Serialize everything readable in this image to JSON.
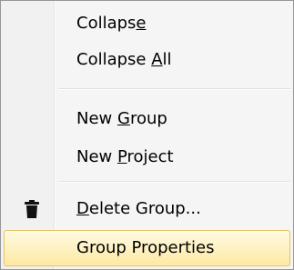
{
  "menu": {
    "items": [
      {
        "pre": "Collaps",
        "mnemonic": "e",
        "post": ""
      },
      {
        "pre": "Collapse ",
        "mnemonic": "A",
        "post": "ll"
      },
      {
        "pre": "New ",
        "mnemonic": "G",
        "post": "roup"
      },
      {
        "pre": "New ",
        "mnemonic": "P",
        "post": "roject"
      },
      {
        "pre": "",
        "mnemonic": "D",
        "post": "elete Group..."
      },
      {
        "pre": "Group Properties",
        "mnemonic": "",
        "post": ""
      }
    ],
    "icons": {
      "delete_group": "trash-icon"
    },
    "colors": {
      "background": "#f5f5f5",
      "gutter": "#f1f1f1",
      "border": "#979797",
      "highlight_border": "#e5c365",
      "highlight_top": "#fffbe2",
      "highlight_bottom": "#fde9a4"
    }
  }
}
